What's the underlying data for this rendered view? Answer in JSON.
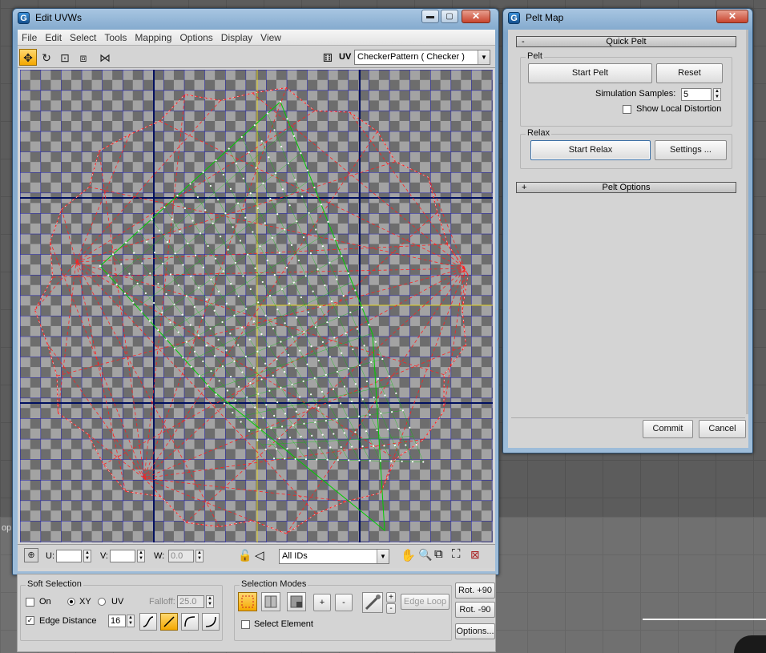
{
  "background_text": "op",
  "edit_uvws": {
    "title": "Edit UVWs",
    "menu": [
      "File",
      "Edit",
      "Select",
      "Tools",
      "Mapping",
      "Options",
      "Display",
      "View"
    ],
    "uv_label": "UV",
    "texture_combo": "CheckerPattern  ( Checker )",
    "u_label": "U:",
    "v_label": "V:",
    "w_label": "W:",
    "w_value": "0.0",
    "ids_combo": "All IDs",
    "soft_selection": {
      "title": "Soft Selection",
      "on_label": "On",
      "xy_label": "XY",
      "uv_label": "UV",
      "falloff_label": "Falloff:",
      "falloff_value": "25.0",
      "edge_distance_label": "Edge Distance",
      "edge_distance_value": "16",
      "edge_distance_checked": true,
      "on_checked": false,
      "mode_selected": "XY"
    },
    "selection_modes": {
      "title": "Selection Modes",
      "plus": "+",
      "minus": "-",
      "edge_loop": "Edge Loop",
      "select_element": "Select Element"
    },
    "rot_plus": "Rot. +90",
    "rot_minus": "Rot. -90",
    "options": "Options..."
  },
  "pelt_map": {
    "title": "Pelt Map",
    "quick_pelt": {
      "sign": "-",
      "label": "Quick Pelt"
    },
    "pelt_group": "Pelt",
    "start_pelt": "Start Pelt",
    "reset": "Reset",
    "simulation_samples_label": "Simulation Samples:",
    "simulation_samples_value": "5",
    "show_local_distortion": "Show Local Distortion",
    "relax_group": "Relax",
    "start_relax": "Start Relax",
    "settings": "Settings ...",
    "pelt_options": {
      "sign": "+",
      "label": "Pelt Options"
    },
    "commit": "Commit",
    "cancel": "Cancel"
  },
  "colors": {
    "accent_yellow": "#f4a800",
    "grid_blue": "#1a1ab0",
    "pelt_red": "#ff2020",
    "mesh_green": "#00cc00",
    "vertex_white": "#ffffff"
  }
}
